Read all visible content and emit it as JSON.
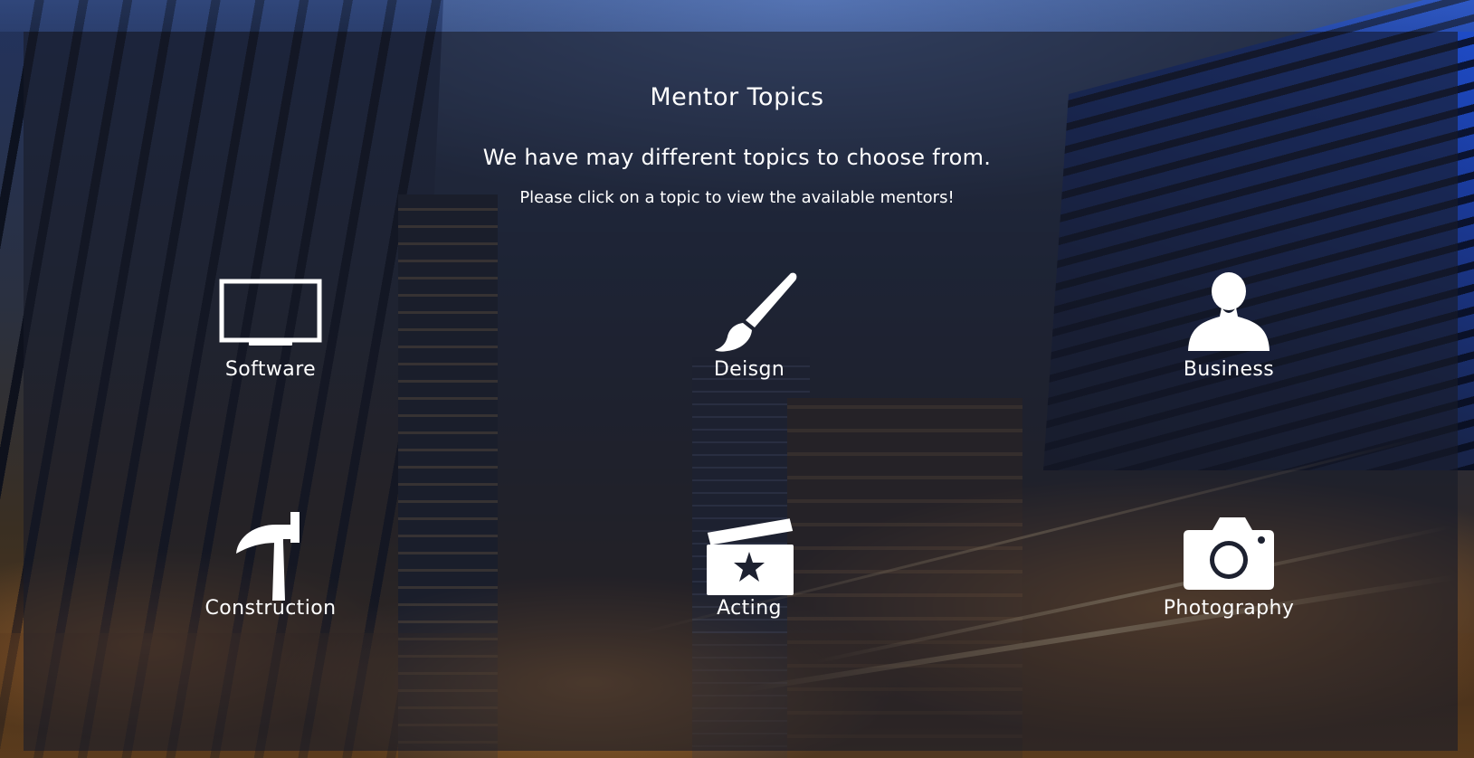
{
  "page": {
    "title": "Mentor Topics",
    "subtitle": "We have may different topics to choose from.",
    "hint": "Please click on a topic to view the available mentors!"
  },
  "topics": [
    {
      "label": "Software",
      "icon": "monitor-icon"
    },
    {
      "label": "Deisgn",
      "icon": "paintbrush-icon"
    },
    {
      "label": "Business",
      "icon": "person-icon"
    },
    {
      "label": "Construction",
      "icon": "hammer-icon"
    },
    {
      "label": "Acting",
      "icon": "clapperboard-icon"
    },
    {
      "label": "Photography",
      "icon": "camera-icon"
    }
  ],
  "colors": {
    "text": "#ffffff",
    "overlay": "#191c28"
  }
}
